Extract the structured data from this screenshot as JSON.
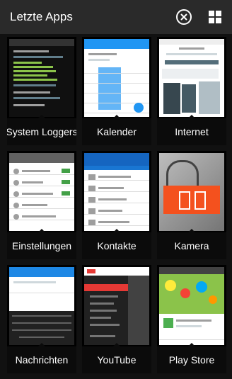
{
  "header": {
    "title": "Letzte Apps",
    "close_icon": "circle-x-icon",
    "layout_icon": "grid-icon"
  },
  "apps": [
    {
      "label": "System Loggers"
    },
    {
      "label": "Kalender"
    },
    {
      "label": "Internet"
    },
    {
      "label": "Einstellungen"
    },
    {
      "label": "Kontakte"
    },
    {
      "label": "Kamera"
    },
    {
      "label": "Nachrichten"
    },
    {
      "label": "YouTube"
    },
    {
      "label": "Play Store"
    }
  ],
  "colors": {
    "background": "#111111",
    "header": "#2a2a2a",
    "calendar_blue": "#2196f3",
    "contacts_blue": "#1565c0",
    "camera_orange": "#f4511e",
    "youtube_red": "#e53935",
    "playstore_green": "#8bc34a"
  }
}
